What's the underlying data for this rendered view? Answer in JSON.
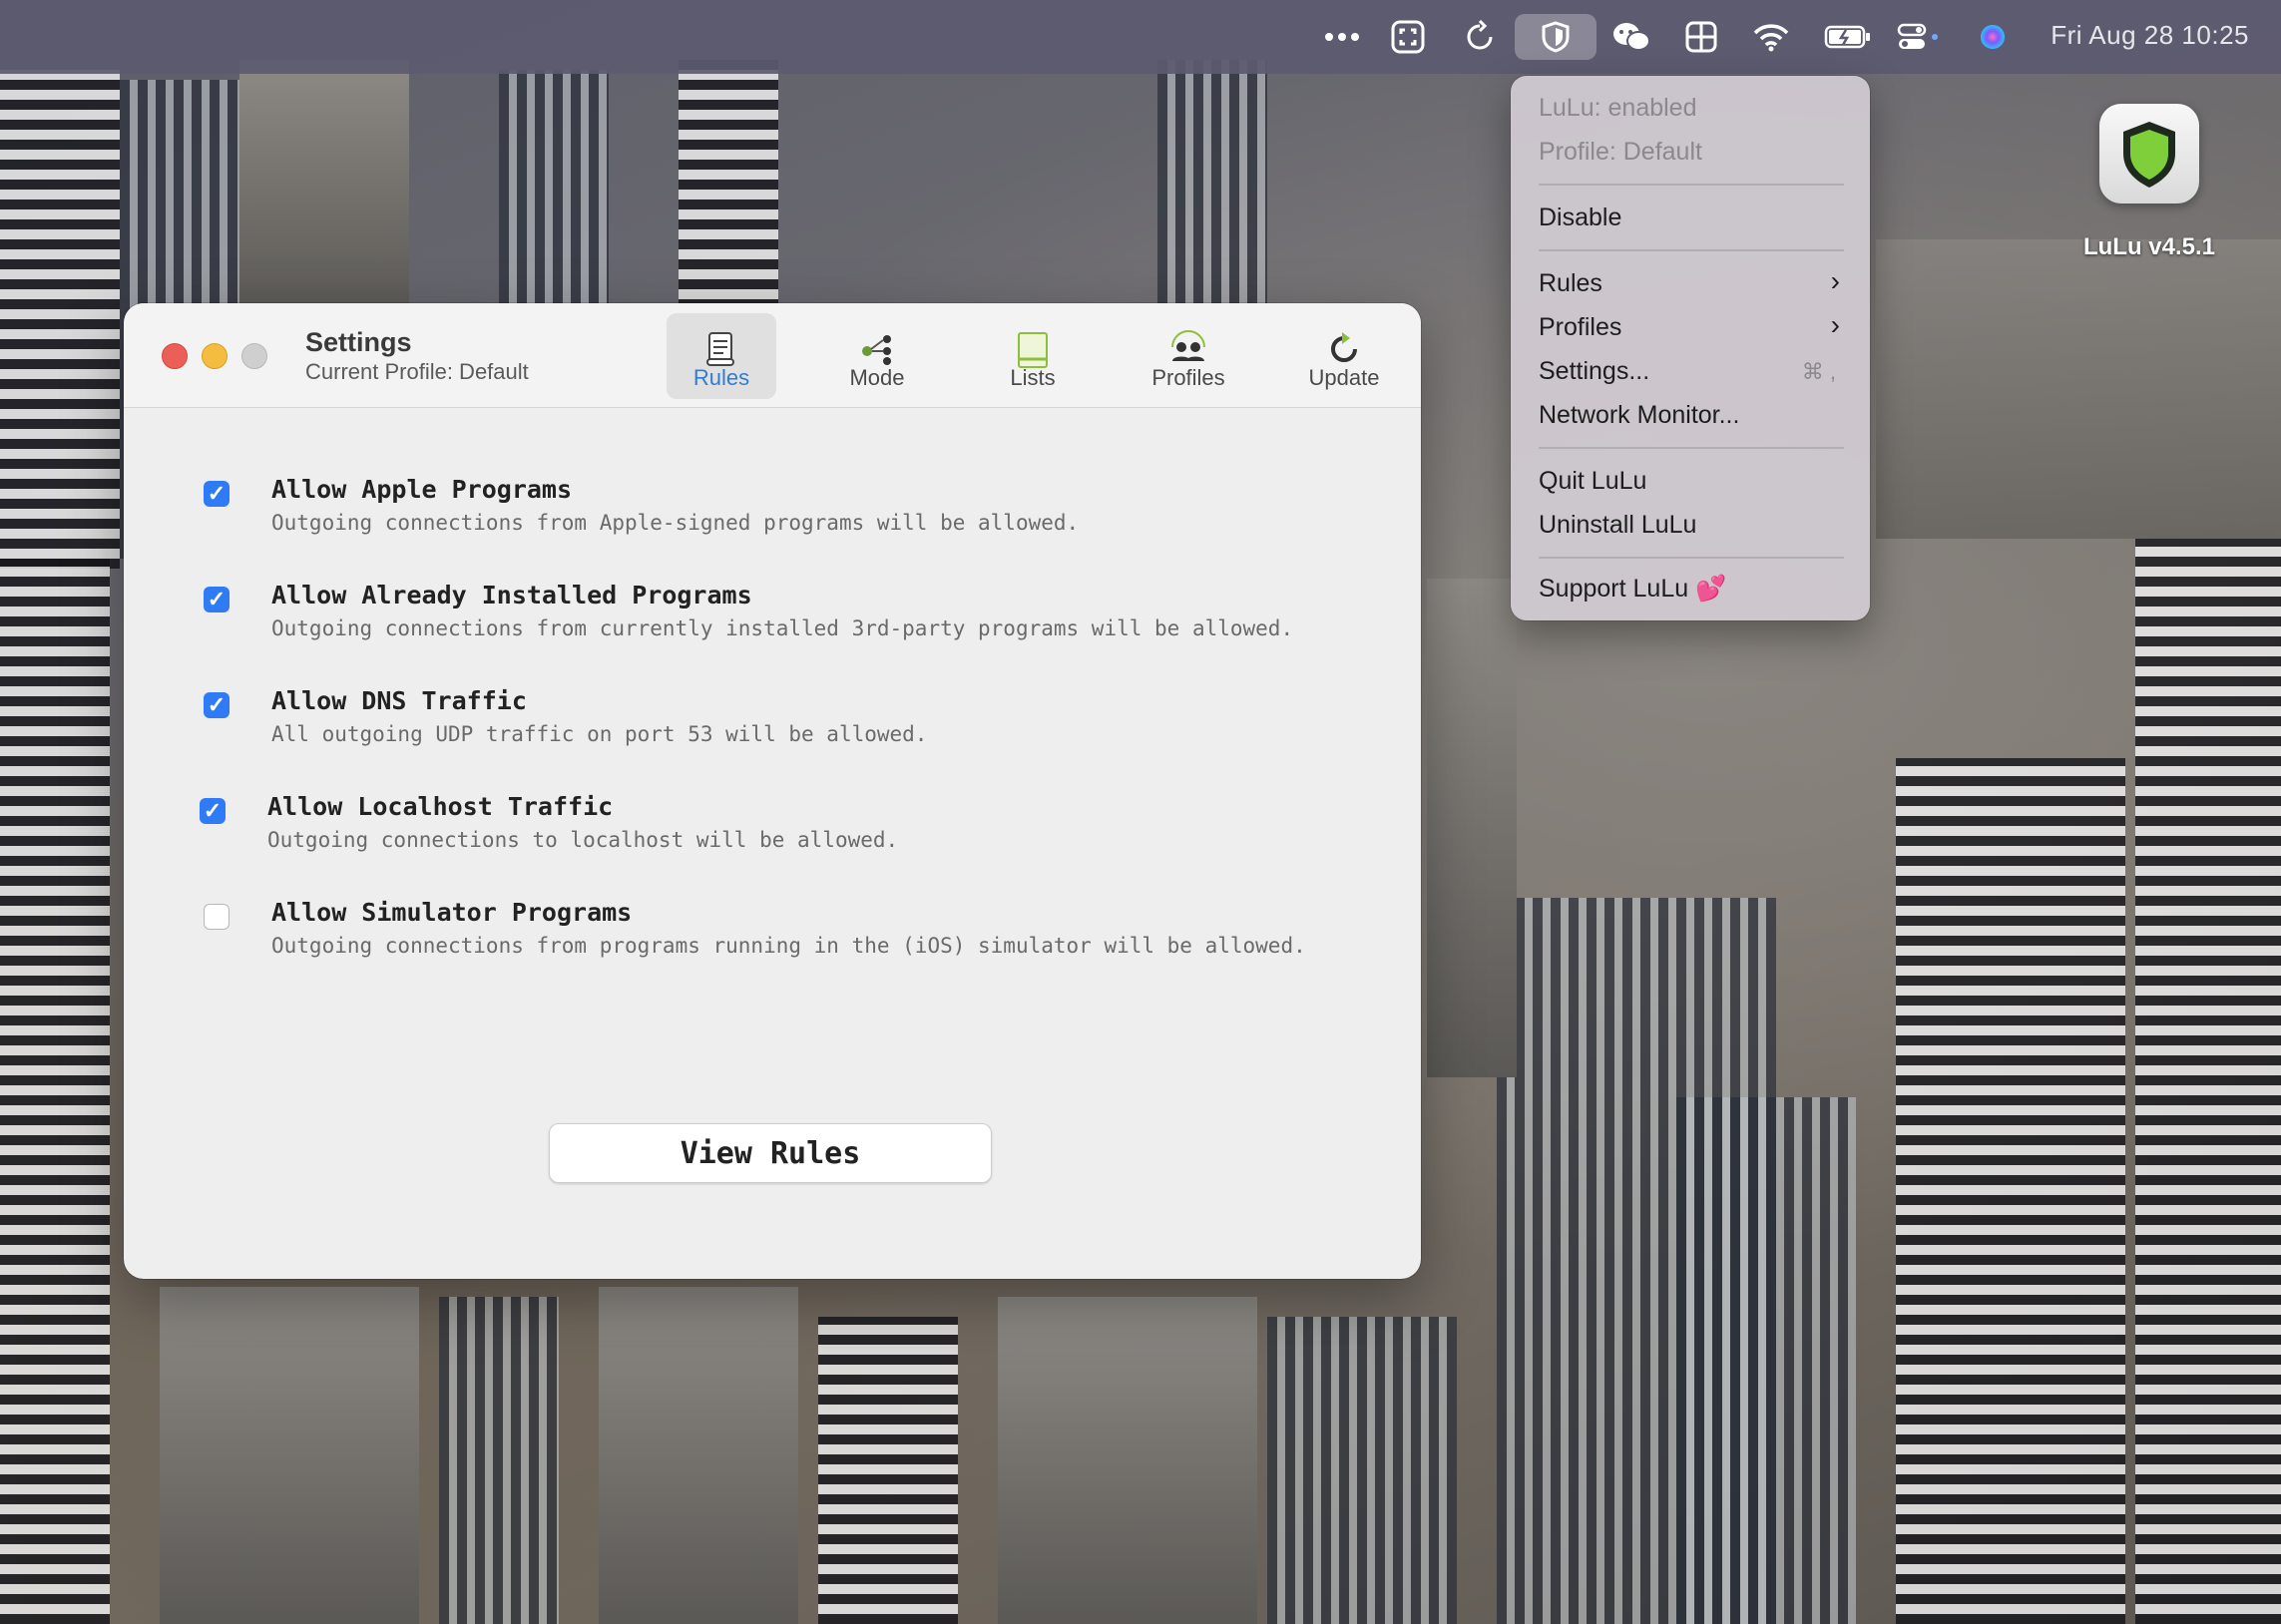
{
  "menubar": {
    "clock": "Fri Aug 28  10:25",
    "icons": [
      "more-icon",
      "screenshot-icon",
      "sync-icon",
      "lulu-shield-icon",
      "wechat-icon",
      "grid-icon",
      "wifi-icon",
      "battery-icon",
      "control-center-icon",
      "siri-icon"
    ]
  },
  "window": {
    "title": "Settings",
    "subtitle": "Current Profile: Default",
    "toolbar": [
      {
        "label": "Rules",
        "icon": "scroll-icon",
        "selected": true
      },
      {
        "label": "Mode",
        "icon": "mode-icon",
        "selected": false
      },
      {
        "label": "Lists",
        "icon": "list-icon",
        "selected": false
      },
      {
        "label": "Profiles",
        "icon": "profiles-icon",
        "selected": false
      },
      {
        "label": "Update",
        "icon": "update-icon",
        "selected": false
      }
    ],
    "rules": [
      {
        "title": "Allow Apple Programs",
        "desc": "Outgoing connections from Apple-signed programs will be allowed.",
        "checked": true
      },
      {
        "title": "Allow Already Installed Programs",
        "desc": "Outgoing connections from currently installed 3rd-party programs will be allowed.",
        "checked": true
      },
      {
        "title": "Allow DNS Traffic",
        "desc": "All outgoing UDP traffic on port 53 will be allowed.",
        "checked": true
      },
      {
        "title": "Allow Localhost Traffic",
        "desc": "Outgoing connections to localhost will be allowed.",
        "checked": true
      },
      {
        "title": "Allow Simulator Programs",
        "desc": "Outgoing connections from programs running in the (iOS) simulator will be allowed.",
        "checked": false
      }
    ],
    "view_rules_label": "View Rules"
  },
  "menu": {
    "status": "LuLu: enabled",
    "profile": "Profile: Default",
    "disable": "Disable",
    "rules": "Rules",
    "profiles": "Profiles",
    "settings": "Settings...",
    "settings_shortcut": "⌘ ,",
    "network_monitor": "Network Monitor...",
    "quit": "Quit LuLu",
    "uninstall": "Uninstall LuLu",
    "support": "Support LuLu 💕"
  },
  "desktop": {
    "app_label": "LuLu v4.5.1"
  },
  "colors": {
    "accent": "#2f7bf6",
    "close": "#ec5f57",
    "minimize": "#f4bd3f"
  }
}
